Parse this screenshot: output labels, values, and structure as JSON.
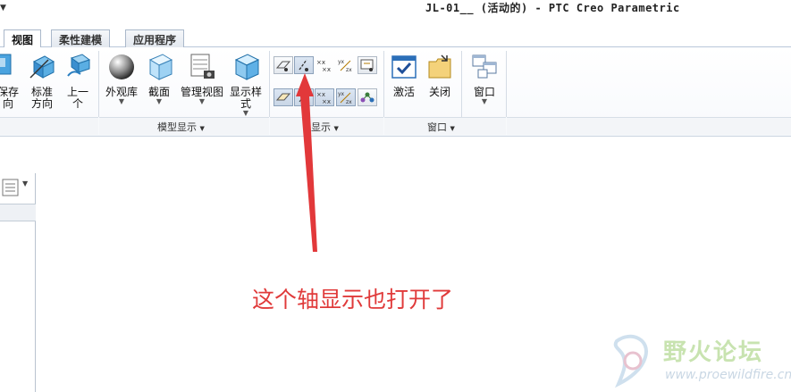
{
  "window": {
    "menu_arrow": "▼",
    "title": "JL-01__ (活动的) - PTC Creo Parametric"
  },
  "tabs": [
    {
      "label": "视图",
      "active": true
    },
    {
      "label": "柔性建模",
      "active": false
    },
    {
      "label": "应用程序",
      "active": false
    }
  ],
  "ribbon": {
    "orient_buttons": [
      {
        "label_line1": "保存",
        "label_line2": "向",
        "icon": "saved-orientation-icon"
      },
      {
        "label_line1": "标准",
        "label_line2": "方向",
        "icon": "standard-orientation-icon"
      },
      {
        "label_line1": "上一",
        "label_line2": "个",
        "icon": "previous-view-icon"
      }
    ],
    "model_display": {
      "group_label": "模型显示",
      "group_dropdown": "▼",
      "buttons": [
        {
          "label_line1": "外观库",
          "label_line2": "",
          "icon": "appearance-gallery-icon",
          "dropdown": "▼"
        },
        {
          "label_line1": "截面",
          "label_line2": "",
          "icon": "section-icon",
          "dropdown": "▼"
        },
        {
          "label_line1": "管理视图",
          "label_line2": "",
          "icon": "manage-views-icon",
          "dropdown": "▼"
        },
        {
          "label_line1": "显示样",
          "label_line2": "式",
          "icon": "display-style-icon",
          "dropdown": "▼"
        }
      ]
    },
    "show": {
      "group_label": "显示",
      "group_dropdown": "▼",
      "icons_row1": [
        "plane-display-icon",
        "axis-display-icon",
        "point-display-icon",
        "csys-display-icon",
        "annotation-display-icon"
      ],
      "icons_row2": [
        "plane-tag-icon",
        "axis-tag-icon",
        "point-tag-icon",
        "csys-tag-icon",
        "spin-center-icon"
      ]
    },
    "window_group": {
      "group_label": "窗口",
      "group_dropdown": "▼",
      "buttons": [
        {
          "label": "激活",
          "icon": "activate-icon"
        },
        {
          "label": "关闭",
          "icon": "close-window-icon"
        },
        {
          "label": "窗口",
          "icon": "windows-icon",
          "dropdown": "▼"
        }
      ]
    }
  },
  "left_panel": {
    "dropdown": "▼",
    "icon": "list-icon"
  },
  "annotation": {
    "text": "这个轴显示也打开了",
    "color": "#e03a3a"
  },
  "watermark": {
    "name": "野火论坛",
    "url": "www.proewildfire.cn"
  },
  "colors": {
    "accent": "#e03a3a",
    "ribbon_border": "#c9d3df"
  }
}
